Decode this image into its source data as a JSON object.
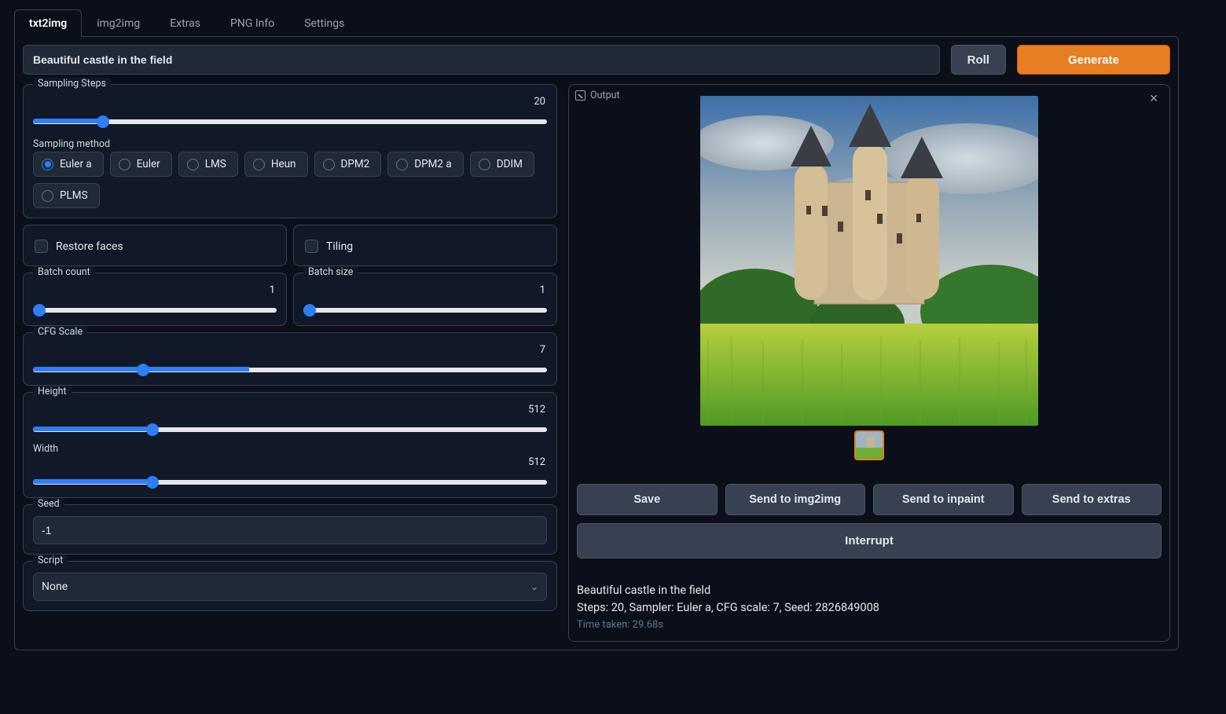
{
  "tabs": [
    "txt2img",
    "img2img",
    "Extras",
    "PNG Info",
    "Settings"
  ],
  "active_tab": 0,
  "prompt": "Beautiful castle in the field",
  "roll_label": "Roll",
  "generate_label": "Generate",
  "sampling_steps": {
    "label": "Sampling Steps",
    "value": 20,
    "min": 1,
    "max": 150,
    "pct": 13.3
  },
  "sampling_method": {
    "label": "Sampling method",
    "options": [
      "Euler a",
      "Euler",
      "LMS",
      "Heun",
      "DPM2",
      "DPM2 a",
      "DDIM",
      "PLMS"
    ],
    "selected": 0
  },
  "restore_faces": {
    "label": "Restore faces",
    "checked": false
  },
  "tiling": {
    "label": "Tiling",
    "checked": false
  },
  "batch_count": {
    "label": "Batch count",
    "value": 1,
    "pct": 0
  },
  "batch_size": {
    "label": "Batch size",
    "value": 1,
    "pct": 0
  },
  "cfg_scale": {
    "label": "CFG Scale",
    "value": 7,
    "pct": 42
  },
  "height": {
    "label": "Height",
    "value": 512,
    "pct": 22.5
  },
  "width": {
    "label": "Width",
    "value": 512,
    "pct": 22.5
  },
  "seed": {
    "label": "Seed",
    "value": "-1"
  },
  "script": {
    "label": "Script",
    "value": "None"
  },
  "output_label": "Output",
  "actions": {
    "save": "Save",
    "send_img2img": "Send to img2img",
    "send_inpaint": "Send to inpaint",
    "send_extras": "Send to extras",
    "interrupt": "Interrupt"
  },
  "result": {
    "prompt_echo": "Beautiful castle in the field",
    "params": "Steps: 20, Sampler: Euler a, CFG scale: 7, Seed: 2826849008",
    "time": "Time taken: 29.68s"
  }
}
